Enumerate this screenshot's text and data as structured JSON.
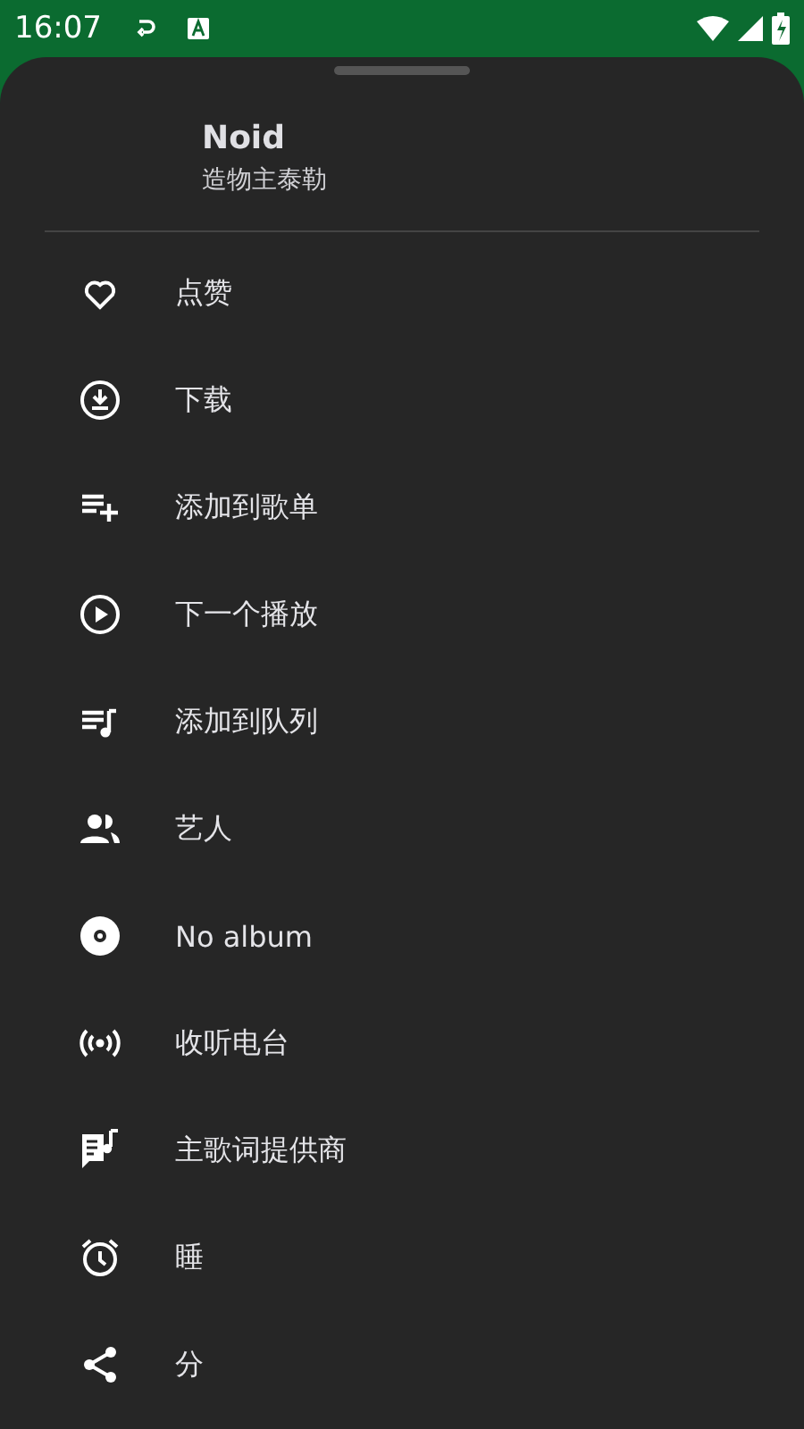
{
  "status_bar": {
    "time": "16:07"
  },
  "header": {
    "title": "Noid",
    "subtitle": "造物主泰勒"
  },
  "menu": [
    {
      "kind": "like",
      "label": "点赞"
    },
    {
      "kind": "download",
      "label": "下载"
    },
    {
      "kind": "playlist-add",
      "label": "添加到歌单"
    },
    {
      "kind": "play-next",
      "label": "下一个播放"
    },
    {
      "kind": "queue",
      "label": "添加到队列"
    },
    {
      "kind": "artist",
      "label": "艺人"
    },
    {
      "kind": "album",
      "label": "No album"
    },
    {
      "kind": "radio",
      "label": "收听电台"
    },
    {
      "kind": "lyrics",
      "label": "主歌词提供商"
    },
    {
      "kind": "timer",
      "label": "睡"
    },
    {
      "kind": "share",
      "label": "分"
    }
  ]
}
